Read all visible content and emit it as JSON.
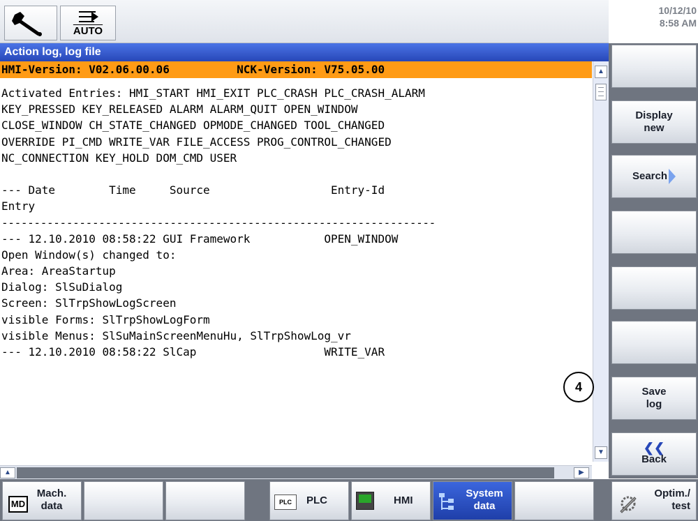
{
  "header": {
    "mode_label": "AUTO",
    "date": "10/12/10",
    "time": "8:58 AM"
  },
  "window": {
    "title": "Action log, log file"
  },
  "version_bar": {
    "hmi": "HMI-Version: V02.06.00.06",
    "nck": "NCK-Version: V75.05.00"
  },
  "log": {
    "lines": [
      "",
      "Activated Entries: HMI_START HMI_EXIT PLC_CRASH PLC_CRASH_ALARM",
      "KEY_PRESSED KEY_RELEASED ALARM ALARM_QUIT OPEN_WINDOW",
      "CLOSE_WINDOW CH_STATE_CHANGED OPMODE_CHANGED TOOL_CHANGED",
      "OVERRIDE PI_CMD WRITE_VAR FILE_ACCESS PROG_CONTROL_CHANGED",
      "NC_CONNECTION KEY_HOLD DOM_CMD USER",
      "",
      "--- Date        Time     Source                  Entry-Id",
      "Entry",
      "-------------------------------------------------------------------",
      "--- 12.10.2010 08:58:22 GUI Framework           OPEN_WINDOW",
      "Open Window(s) changed to:",
      "Area: AreaStartup",
      "Dialog: SlSuDialog",
      "Screen: SlTrpShowLogScreen",
      "visible Forms: SlTrpShowLogForm",
      "visible Menus: SlSuMainScreenMenuHu, SlTrpShowLog_vr",
      "--- 12.10.2010 08:58:22 SlCap                   WRITE_VAR"
    ]
  },
  "softkeys_right": [
    {
      "label": ""
    },
    {
      "label": "Display new"
    },
    {
      "label": "Search"
    },
    {
      "label": ""
    },
    {
      "label": ""
    },
    {
      "label": ""
    },
    {
      "label": "Save log"
    },
    {
      "label": "Back"
    }
  ],
  "softkeys_bottom": {
    "mach_data": "Mach. data",
    "md_icon": "MD",
    "plc_icon": "PLC",
    "plc": "PLC",
    "hmi": "HMI",
    "system_data": "System data",
    "optim_test": "Optim./ test"
  },
  "callout": "4",
  "icons": {
    "wrench": "wrench-icon",
    "auto_mode": "auto-mode-arrow-icon",
    "search_arrow": "arrow-right-icon",
    "back": "double-chevron-left-icon",
    "hmi": "hmi-monitor-icon",
    "system": "system-tree-icon",
    "optim": "wrench-gear-icon"
  },
  "colors": {
    "title_bar": "#2747b8",
    "version_bar": "#ff9b15",
    "softkey_panel": "#6f7580",
    "active_softkey": "#2747b8"
  }
}
